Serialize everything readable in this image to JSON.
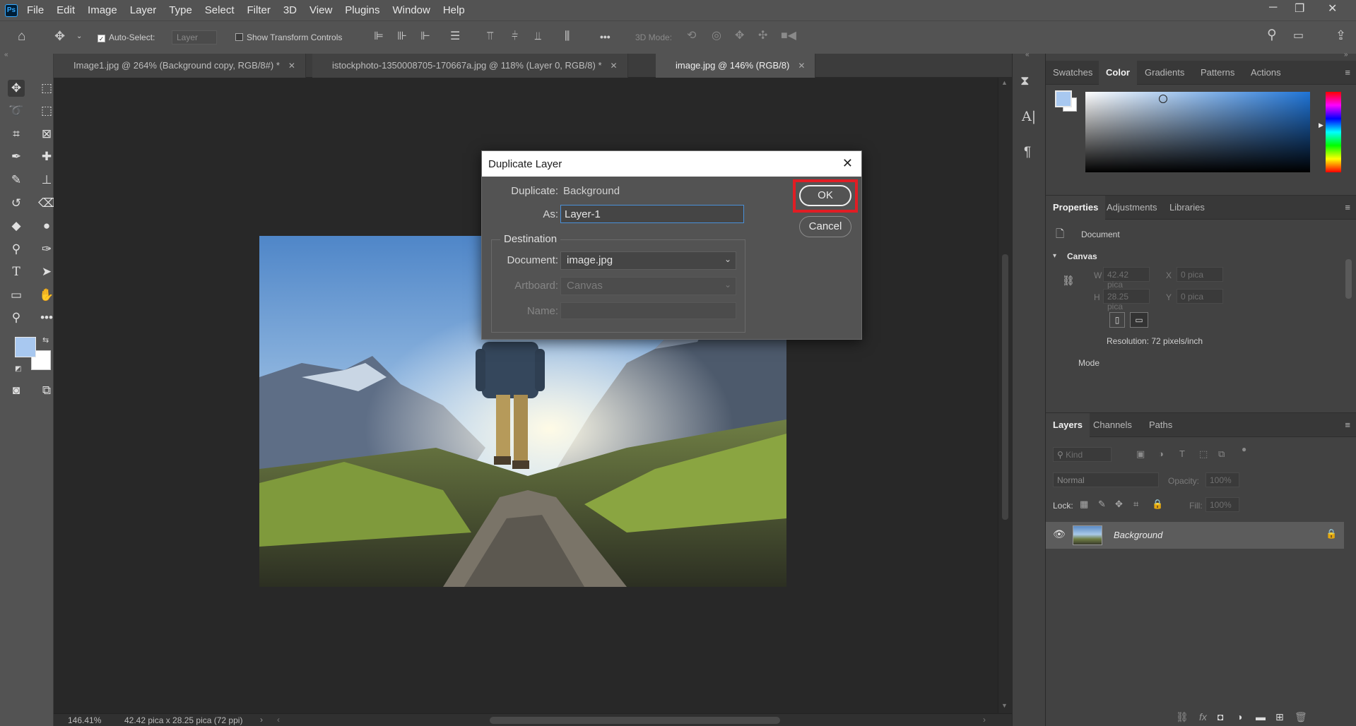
{
  "app": {
    "logo": "Ps",
    "menu": [
      "File",
      "Edit",
      "Image",
      "Layer",
      "Type",
      "Select",
      "Filter",
      "3D",
      "View",
      "Plugins",
      "Window",
      "Help"
    ]
  },
  "options_bar": {
    "auto_select_label": "Auto-Select:",
    "auto_select_target": "Layer",
    "show_transform_label": "Show Transform Controls",
    "three_d_mode_label": "3D Mode:",
    "more_glyph": "•••"
  },
  "tabs": [
    {
      "label": "Image1.jpg @ 264% (Background copy, RGB/8#) *"
    },
    {
      "label": "istockphoto-1350008705-170667a.jpg @ 118% (Layer 0, RGB/8) *"
    },
    {
      "label": "image.jpg @ 146% (RGB/8)"
    }
  ],
  "status": {
    "zoom": "146.41%",
    "doc_size": "42.42 pica x 28.25 pica (72 ppi)"
  },
  "color_panel": {
    "tabs": [
      "Swatches",
      "Color",
      "Gradients",
      "Patterns",
      "Actions"
    ],
    "active_tab": "Color",
    "foreground_color": "#a8c8f0",
    "background_color": "#ffffff"
  },
  "properties_panel": {
    "tabs": [
      "Properties",
      "Adjustments",
      "Libraries"
    ],
    "document_label": "Document",
    "canvas_header": "Canvas",
    "w_label": "W",
    "w_value": "42.42 pica",
    "h_label": "H",
    "h_value": "28.25 pica",
    "x_label": "X",
    "x_value": "0 pica",
    "y_label": "Y",
    "y_value": "0 pica",
    "resolution": "Resolution: 72 pixels/inch",
    "mode_label": "Mode"
  },
  "layers_panel": {
    "tabs": [
      "Layers",
      "Channels",
      "Paths"
    ],
    "kind_label": "Kind",
    "blend_mode": "Normal",
    "opacity_label": "Opacity:",
    "opacity_value": "100%",
    "lock_label": "Lock:",
    "fill_label": "Fill:",
    "fill_value": "100%",
    "layers": [
      {
        "name": "Background"
      }
    ]
  },
  "dialog": {
    "title": "Duplicate Layer",
    "duplicate_label": "Duplicate:",
    "duplicate_value": "Background",
    "as_label": "As:",
    "as_value": "Layer-1",
    "destination_label": "Destination",
    "document_label": "Document:",
    "document_value": "image.jpg",
    "artboard_label": "Artboard:",
    "artboard_value": "Canvas",
    "name_label": "Name:",
    "name_value": "",
    "ok_label": "OK",
    "cancel_label": "Cancel",
    "highlight_color": "#e11d24"
  }
}
